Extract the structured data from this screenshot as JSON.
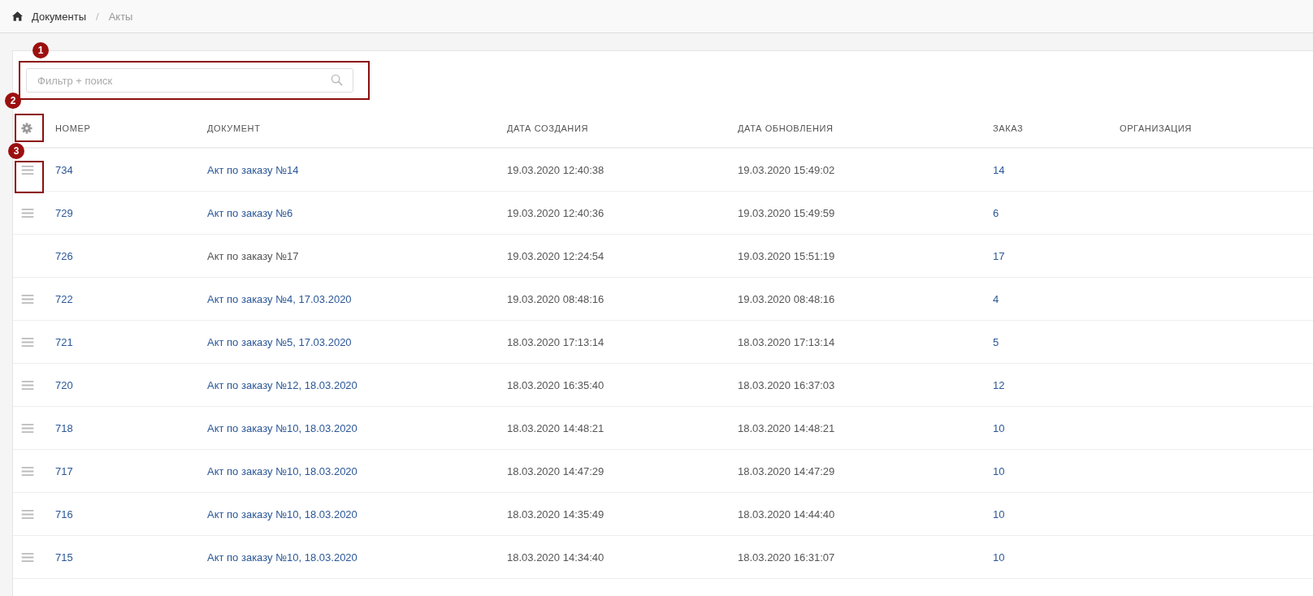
{
  "breadcrumb": [
    {
      "label": "Документы",
      "current": false
    },
    {
      "label": "Акты",
      "current": true
    }
  ],
  "breadcrumb_separator": "/",
  "search": {
    "placeholder": "Фильтр + поиск"
  },
  "table": {
    "columns": [
      "НОМЕР",
      "ДОКУМЕНТ",
      "ДАТА СОЗДАНИЯ",
      "ДАТА ОБНОВЛЕНИЯ",
      "ЗАКАЗ",
      "ОРГАНИЗАЦИЯ"
    ],
    "rows": [
      {
        "menu": true,
        "number": "734",
        "document": "Акт по заказу №14",
        "document_linked": true,
        "created": "19.03.2020 12:40:38",
        "updated": "19.03.2020 15:49:02",
        "order": "14"
      },
      {
        "menu": true,
        "number": "729",
        "document": "Акт по заказу №6",
        "document_linked": true,
        "created": "19.03.2020 12:40:36",
        "updated": "19.03.2020 15:49:59",
        "order": "6"
      },
      {
        "menu": false,
        "number": "726",
        "document": "Акт по заказу №17",
        "document_linked": false,
        "created": "19.03.2020 12:24:54",
        "updated": "19.03.2020 15:51:19",
        "order": "17"
      },
      {
        "menu": true,
        "number": "722",
        "document": "Акт по заказу №4, 17.03.2020",
        "document_linked": true,
        "created": "19.03.2020 08:48:16",
        "updated": "19.03.2020 08:48:16",
        "order": "4"
      },
      {
        "menu": true,
        "number": "721",
        "document": "Акт по заказу №5, 17.03.2020",
        "document_linked": true,
        "created": "18.03.2020 17:13:14",
        "updated": "18.03.2020 17:13:14",
        "order": "5"
      },
      {
        "menu": true,
        "number": "720",
        "document": "Акт по заказу №12, 18.03.2020",
        "document_linked": true,
        "created": "18.03.2020 16:35:40",
        "updated": "18.03.2020 16:37:03",
        "order": "12"
      },
      {
        "menu": true,
        "number": "718",
        "document": "Акт по заказу №10, 18.03.2020",
        "document_linked": true,
        "created": "18.03.2020 14:48:21",
        "updated": "18.03.2020 14:48:21",
        "order": "10"
      },
      {
        "menu": true,
        "number": "717",
        "document": "Акт по заказу №10, 18.03.2020",
        "document_linked": true,
        "created": "18.03.2020 14:47:29",
        "updated": "18.03.2020 14:47:29",
        "order": "10"
      },
      {
        "menu": true,
        "number": "716",
        "document": "Акт по заказу №10, 18.03.2020",
        "document_linked": true,
        "created": "18.03.2020 14:35:49",
        "updated": "18.03.2020 14:44:40",
        "order": "10"
      },
      {
        "menu": true,
        "number": "715",
        "document": "Акт по заказу №10, 18.03.2020",
        "document_linked": true,
        "created": "18.03.2020 14:34:40",
        "updated": "18.03.2020 16:31:07",
        "order": "10"
      }
    ]
  },
  "callouts": [
    {
      "label": "1"
    },
    {
      "label": "2"
    },
    {
      "label": "3"
    }
  ]
}
